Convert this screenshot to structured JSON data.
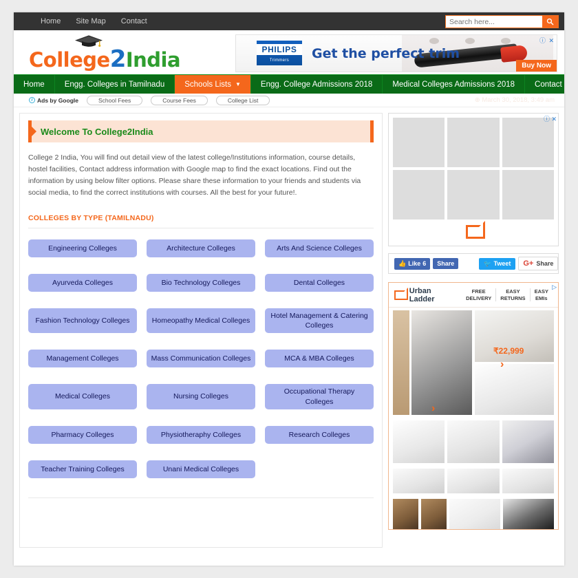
{
  "topbar": {
    "links": [
      "Home",
      "Site Map",
      "Contact"
    ],
    "search": {
      "placeholder": "Search here...",
      "value": ""
    },
    "search_icon": "search-icon"
  },
  "logo": {
    "part1": "College",
    "part2": "2",
    "part3": "India"
  },
  "header_ad": {
    "brand": "PHILIPS",
    "brand_sub": "Trimmers",
    "headline": "Get the perfect trim",
    "cta": "Buy Now",
    "close": "ⓘ ✕"
  },
  "nav": {
    "items": [
      {
        "label": "Home",
        "active": false,
        "caret": ""
      },
      {
        "label": "Engg. Colleges in Tamilnadu",
        "active": false,
        "caret": ""
      },
      {
        "label": "Schools Lists",
        "active": true,
        "caret": "▼"
      },
      {
        "label": "Engg. College Admissions 2018",
        "active": false,
        "caret": ""
      },
      {
        "label": "Medical Colleges Admissions 2018",
        "active": false,
        "caret": ""
      },
      {
        "label": "Contact",
        "active": false,
        "caret": ""
      }
    ]
  },
  "adstrip": {
    "label": "Ads by Google",
    "info_icon": "info-icon",
    "pills": [
      "School Fees",
      "Course Fees",
      "College List"
    ],
    "date": "⊕ March 30, 2018, 3:49 am"
  },
  "main": {
    "welcome_title": "Welcome To College2India",
    "intro": "College 2 India, You will find out detail view of the latest college/Institutions information, course details, hostel facilities, Contact address information with Google map to find the exact locations. Find out the information by using below filter options. Please share these information to your friends and students via social media, to find the correct institutions with courses. All the best for your future!.",
    "section_title": "COLLEGES BY TYPE (TAMILNADU)",
    "college_types": [
      "Engineering Colleges",
      "Architecture Colleges",
      "Arts And Science Colleges",
      "Ayurveda Colleges",
      "Bio Technology Colleges",
      "Dental Colleges",
      "Fashion Technology Colleges",
      "Homeopathy Medical Colleges",
      "Hotel Management & Catering Colleges",
      "Management Colleges",
      "Mass Communication Colleges",
      "MCA & MBA Colleges",
      "Medical Colleges",
      "Nursing Colleges",
      "Occupational Therapy Colleges",
      "Pharmacy Colleges",
      "Physiotheraphy Colleges",
      "Research Colleges",
      "Teacher Training Colleges",
      "Unani Medical Colleges"
    ]
  },
  "sidebar": {
    "ad_top": {
      "adchoices": "ⓘ ✕",
      "brand_mark": "urban-ladder-logo"
    },
    "social": {
      "fb_like": "Like",
      "fb_like_count": "6",
      "fb_share": "Share",
      "twitter": "Tweet",
      "gplus_g": "G+",
      "gplus_share": "Share"
    },
    "ad_bottom": {
      "brand": "Urban Ladder",
      "features": [
        "FREE\nDELIVERY",
        "EASY\nRETURNS",
        "EASY\nEMIs"
      ],
      "feature_1_line1": "FREE",
      "feature_1_line2": "DELIVERY",
      "feature_2_line1": "EASY",
      "feature_2_line2": "RETURNS",
      "feature_3_line1": "EASY",
      "feature_3_line2": "EMIs",
      "price": "₹22,999",
      "chevron": "›",
      "adchoices": "▷"
    }
  },
  "colors": {
    "nav_green": "#0a6b17",
    "accent_orange": "#f4671c",
    "button_blue": "#aab4ef",
    "button_text": "#14185a",
    "topbar_dark": "#333333"
  }
}
